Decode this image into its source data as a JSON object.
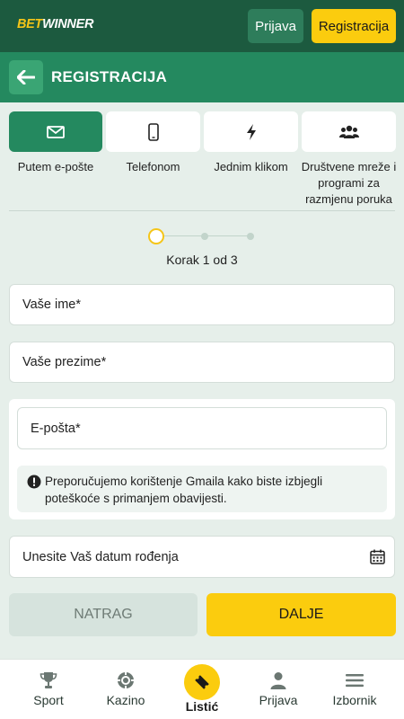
{
  "brand": {
    "part1": "BET",
    "part2": "WINNER"
  },
  "header": {
    "login_label": "Prijava",
    "register_label": "Registracija"
  },
  "page": {
    "title": "REGISTRACIJA"
  },
  "methods": [
    {
      "label": "Putem e-pošte",
      "icon": "envelope-icon",
      "active": true
    },
    {
      "label": "Telefonom",
      "icon": "phone-icon",
      "active": false
    },
    {
      "label": "Jednim klikom",
      "icon": "lightning-icon",
      "active": false
    },
    {
      "label": "Društvene mreže i programi za razmjenu poruka",
      "icon": "users-icon",
      "active": false
    }
  ],
  "stepper": {
    "text": "Korak 1 od 3",
    "current": 1,
    "total": 3
  },
  "form": {
    "first_name_placeholder": "Vaše ime*",
    "last_name_placeholder": "Vaše prezime*",
    "email_placeholder": "E-pošta*",
    "email_notice": "Preporučujemo korištenje Gmaila kako biste izbjegli poteškoće s primanjem obavijesti.",
    "birthdate_placeholder": "Unesite Vaš datum rođenja"
  },
  "actions": {
    "back_label": "NATRAG",
    "next_label": "DALJE"
  },
  "bottom_nav": [
    {
      "label": "Sport",
      "icon": "trophy-icon"
    },
    {
      "label": "Kazino",
      "icon": "casino-chip-icon"
    },
    {
      "label": "Listić",
      "icon": "ticket-icon"
    },
    {
      "label": "Prijava",
      "icon": "user-icon"
    },
    {
      "label": "Izbornik",
      "icon": "menu-icon"
    }
  ],
  "colors": {
    "primary": "#24895f",
    "dark": "#1c5a3f",
    "accent": "#fbcc0e",
    "background": "#e6efea"
  }
}
